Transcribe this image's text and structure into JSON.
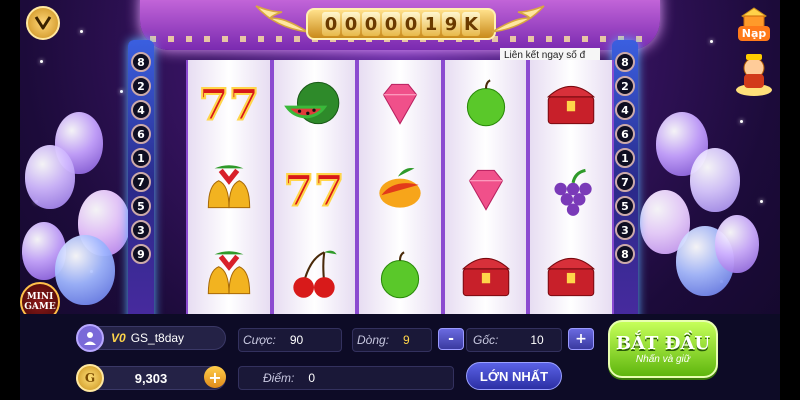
{
  "game": {
    "jackpot_digits": [
      "0",
      "0",
      "0",
      "0",
      "0",
      "1",
      "9",
      "K"
    ],
    "marquee": "Liên kết ngay số đ",
    "nap_label": "Nạp",
    "mini_game_label": "MINI GAME"
  },
  "paylines": {
    "left": [
      "8",
      "2",
      "4",
      "6",
      "1",
      "7",
      "5",
      "3",
      "9"
    ],
    "right": [
      "8",
      "2",
      "4",
      "6",
      "1",
      "7",
      "5",
      "3",
      "8"
    ]
  },
  "reels": [
    [
      "seven-icon",
      "bells-icon",
      "bells-icon"
    ],
    [
      "watermelon-icon",
      "seven-icon",
      "cherry-icon"
    ],
    [
      "gem-icon",
      "mango-icon",
      "apple-icon"
    ],
    [
      "apple-icon",
      "gem-icon",
      "chest-icon"
    ],
    [
      "chest-icon",
      "grapes-icon",
      "chest-icon"
    ]
  ],
  "player": {
    "vip": "V0",
    "name": "GS_t8day",
    "balance": "9,303",
    "coin_symbol": "G"
  },
  "controls": {
    "cuoc_label": "Cược:",
    "cuoc_value": "90",
    "dong_label": "Dòng:",
    "dong_value": "9",
    "goc_label": "Gốc:",
    "goc_value": "10",
    "diem_label": "Điểm:",
    "diem_value": "0",
    "minus": "-",
    "plus": "+",
    "max_bet": "LỚN NHẤT",
    "start": "BẮT ĐẦU",
    "start_sub": "Nhấn và giữ"
  },
  "colors": {
    "start_button": "#7fd11f",
    "max_bet_button": "#3b40c0",
    "dong_value": "#ffd54a"
  }
}
